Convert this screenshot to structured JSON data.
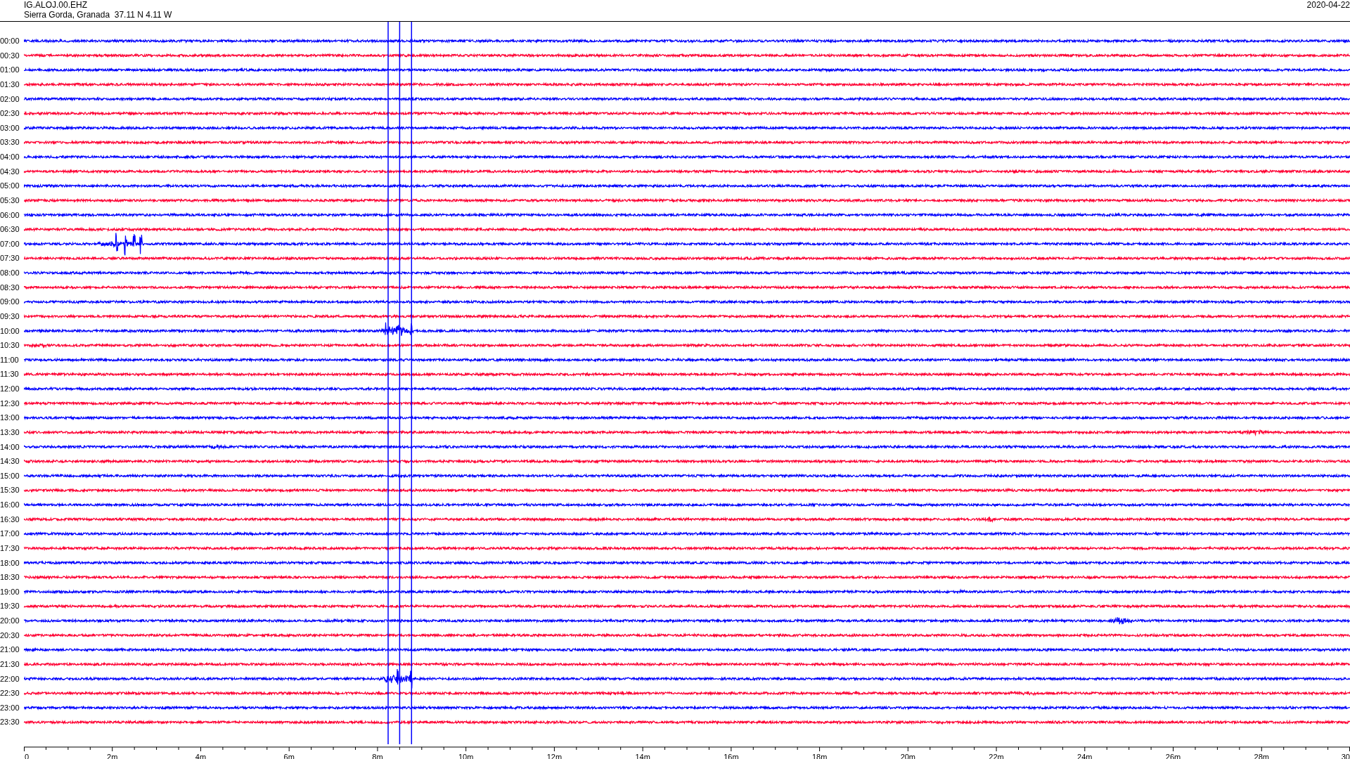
{
  "header": {
    "channel": "IG.ALOJ.00.EHZ",
    "location": "Sierra Gorda, Granada  37.11 N 4.11 W",
    "date": "2020-04-22"
  },
  "traces": [
    {
      "time": "00:00",
      "color": "#0000ff"
    },
    {
      "time": "00:30",
      "color": "#ff0033"
    },
    {
      "time": "01:00",
      "color": "#0000ff"
    },
    {
      "time": "01:30",
      "color": "#ff0033"
    },
    {
      "time": "02:00",
      "color": "#0000ff"
    },
    {
      "time": "02:30",
      "color": "#ff0033"
    },
    {
      "time": "03:00",
      "color": "#0000ff"
    },
    {
      "time": "03:30",
      "color": "#ff0033"
    },
    {
      "time": "04:00",
      "color": "#0000ff"
    },
    {
      "time": "04:30",
      "color": "#ff0033"
    },
    {
      "time": "05:00",
      "color": "#0000ff"
    },
    {
      "time": "05:30",
      "color": "#ff0033"
    },
    {
      "time": "06:00",
      "color": "#0000ff"
    },
    {
      "time": "06:30",
      "color": "#ff0033"
    },
    {
      "time": "07:00",
      "color": "#0000ff"
    },
    {
      "time": "07:30",
      "color": "#ff0033"
    },
    {
      "time": "08:00",
      "color": "#0000ff"
    },
    {
      "time": "08:30",
      "color": "#ff0033"
    },
    {
      "time": "09:00",
      "color": "#0000ff"
    },
    {
      "time": "09:30",
      "color": "#ff0033"
    },
    {
      "time": "10:00",
      "color": "#0000ff"
    },
    {
      "time": "10:30",
      "color": "#ff0033"
    },
    {
      "time": "11:00",
      "color": "#0000ff"
    },
    {
      "time": "11:30",
      "color": "#ff0033"
    },
    {
      "time": "12:00",
      "color": "#0000ff"
    },
    {
      "time": "12:30",
      "color": "#ff0033"
    },
    {
      "time": "13:00",
      "color": "#0000ff"
    },
    {
      "time": "13:30",
      "color": "#ff0033"
    },
    {
      "time": "14:00",
      "color": "#0000ff"
    },
    {
      "time": "14:30",
      "color": "#ff0033"
    },
    {
      "time": "15:00",
      "color": "#0000ff"
    },
    {
      "time": "15:30",
      "color": "#ff0033"
    },
    {
      "time": "16:00",
      "color": "#0000ff"
    },
    {
      "time": "16:30",
      "color": "#ff0033"
    },
    {
      "time": "17:00",
      "color": "#0000ff"
    },
    {
      "time": "17:30",
      "color": "#ff0033"
    },
    {
      "time": "18:00",
      "color": "#0000ff"
    },
    {
      "time": "18:30",
      "color": "#ff0033"
    },
    {
      "time": "19:00",
      "color": "#0000ff"
    },
    {
      "time": "19:30",
      "color": "#ff0033"
    },
    {
      "time": "20:00",
      "color": "#0000ff"
    },
    {
      "time": "20:30",
      "color": "#ff0033"
    },
    {
      "time": "21:00",
      "color": "#0000ff"
    },
    {
      "time": "21:30",
      "color": "#ff0033"
    },
    {
      "time": "22:00",
      "color": "#0000ff"
    },
    {
      "time": "22:30",
      "color": "#ff0033"
    },
    {
      "time": "23:00",
      "color": "#0000ff"
    },
    {
      "time": "23:30",
      "color": "#ff0033"
    }
  ],
  "x_axis": {
    "labels": [
      "0",
      "2m",
      "4m",
      "6m",
      "8m",
      "10m",
      "12m",
      "14m",
      "16m",
      "18m",
      "20m",
      "22m",
      "24m",
      "26m",
      "28m",
      "30"
    ]
  }
}
